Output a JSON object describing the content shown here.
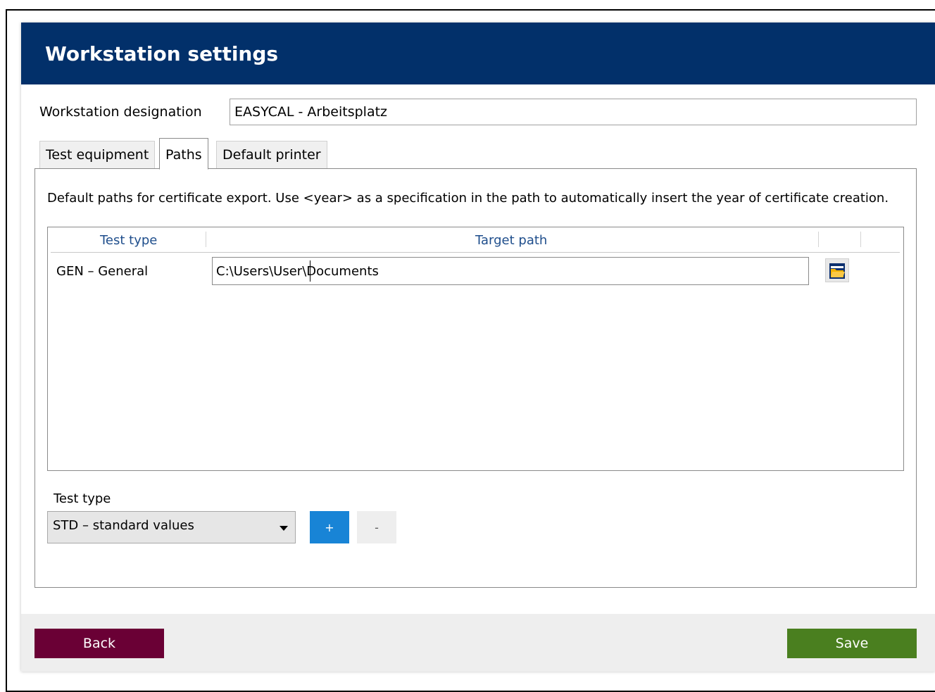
{
  "header": {
    "title": "Workstation settings"
  },
  "designation": {
    "label": "Workstation designation",
    "value": "EASYCAL - Arbeitsplatz"
  },
  "tabs": [
    {
      "label": "Test equipment",
      "active": false
    },
    {
      "label": "Paths",
      "active": true
    },
    {
      "label": "Default printer",
      "active": false
    }
  ],
  "paths_tab": {
    "info": "Default paths for certificate export. Use <year> as a specification in the path to automatically insert the year of certificate creation.",
    "columns": [
      "Test type",
      "Target path"
    ],
    "rows": [
      {
        "test_type": "GEN – General",
        "target_path": "C:\\Users\\User\\Documents"
      }
    ],
    "test_type_label": "Test type",
    "test_type_selected": "STD – standard values",
    "add_label": "+",
    "remove_label": "-"
  },
  "footer": {
    "back_label": "Back",
    "save_label": "Save"
  },
  "colors": {
    "header": "#02306a",
    "back": "#6a0035",
    "save": "#4a7f1f",
    "add": "#1884d6"
  }
}
